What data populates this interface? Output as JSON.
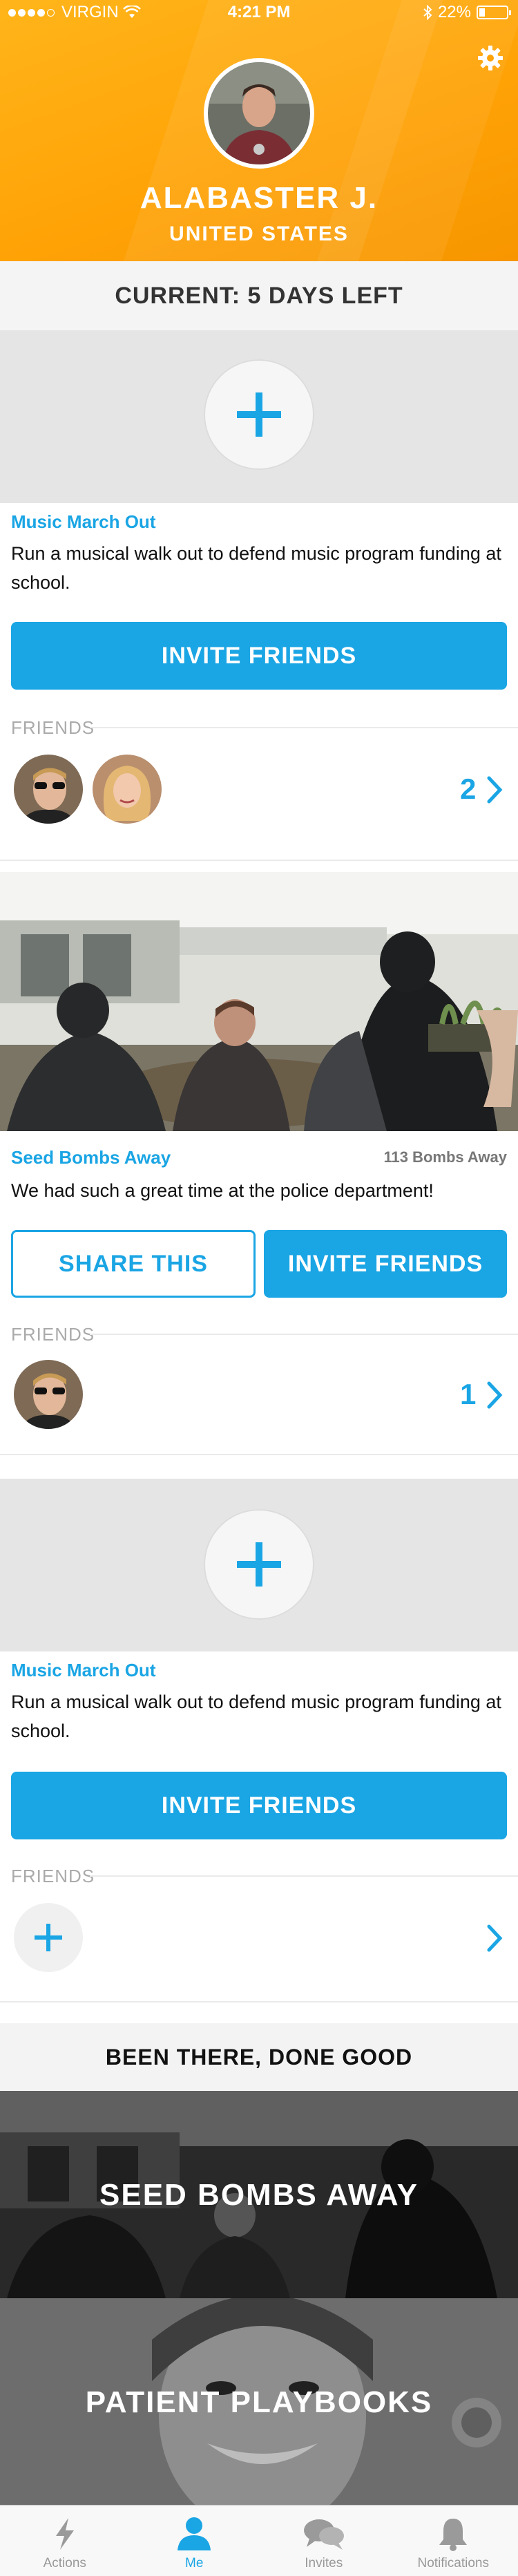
{
  "status_bar": {
    "carrier": "VIRGIN",
    "time": "4:21 PM",
    "battery": "22%",
    "battery_level": 0.22
  },
  "profile": {
    "name": "ALABASTER J.",
    "country": "UNITED STATES",
    "settings_icon": "gear-icon"
  },
  "current": {
    "label": "CURRENT:  5 DAYS LEFT"
  },
  "actions": [
    {
      "title": "Music March Out",
      "description": "Run a musical walk out to defend music program funding at school.",
      "invite_label": "INVITE FRIENDS",
      "friends_label": "FRIENDS",
      "friend_count": "2"
    },
    {
      "title": "Seed Bombs Away",
      "count": "113 Bombs Away",
      "description": "We had such a great time at the police department!",
      "share_label": "SHARE THIS",
      "invite_label": "INVITE FRIENDS",
      "friends_label": "FRIENDS",
      "friend_count": "1"
    },
    {
      "title": "Music March Out",
      "description": "Run a musical walk out to defend music program funding at school.",
      "invite_label": "INVITE FRIENDS",
      "friends_label": "FRIENDS"
    }
  ],
  "been_there": {
    "title": "BEEN THERE, DONE GOOD",
    "items": [
      {
        "label": "SEED BOMBS AWAY"
      },
      {
        "label": "PATIENT PLAYBOOKS"
      }
    ]
  },
  "tabbar": {
    "items": [
      {
        "label": "Actions",
        "icon": "lightning-icon",
        "active": false
      },
      {
        "label": "Me",
        "icon": "person-icon",
        "active": true
      },
      {
        "label": "Invites",
        "icon": "chat-bubbles-icon",
        "active": false
      },
      {
        "label": "Notifications",
        "icon": "bell-icon",
        "active": false
      }
    ]
  },
  "colors": {
    "accent_blue": "#1aa5e4",
    "header_orange": "#ffa307",
    "muted_gray": "#aaaaaa"
  }
}
